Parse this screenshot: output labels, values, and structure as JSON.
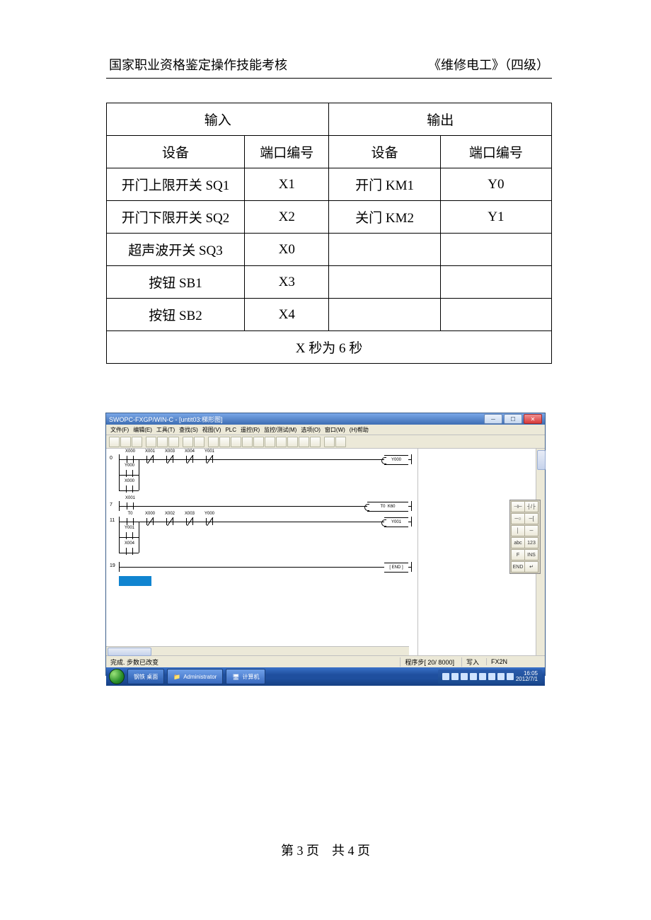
{
  "header": {
    "left": "国家职业资格鉴定操作技能考核",
    "right": "《维修电工》（四级）"
  },
  "iotable": {
    "h_input": "输入",
    "h_output": "输出",
    "h_dev": "设备",
    "h_port": "端口编号",
    "rows": [
      {
        "in_dev": "开门上限开关 SQ1",
        "in_port": "X1",
        "out_dev": "开门 KM1",
        "out_port": "Y0"
      },
      {
        "in_dev": "开门下限开关 SQ2",
        "in_port": "X2",
        "out_dev": "关门 KM2",
        "out_port": "Y1"
      },
      {
        "in_dev": "超声波开关 SQ3",
        "in_port": "X0",
        "out_dev": "",
        "out_port": ""
      },
      {
        "in_dev": "按钮 SB1",
        "in_port": "X3",
        "out_dev": "",
        "out_port": ""
      },
      {
        "in_dev": "按钮 SB2",
        "in_port": "X4",
        "out_dev": "",
        "out_port": ""
      }
    ],
    "footnote": "X 秒为 6 秒"
  },
  "app": {
    "title": "SWOPC-FXGP/WIN-C - [untit03:梯形图]",
    "menus": [
      "文件(F)",
      "编辑(E)",
      "工具(T)",
      "查找(S)",
      "视图(V)",
      "PLC",
      "遥控(R)",
      "监控/测试(M)",
      "选项(O)",
      "窗口(W)",
      "(H)帮助"
    ],
    "ladder": {
      "rung0": {
        "num": "0",
        "contacts": [
          "X000",
          "X001",
          "X003",
          "X004",
          "Y001"
        ],
        "closed": [
          false,
          true,
          true,
          true,
          true
        ],
        "coil": "Y000"
      },
      "branchA": [
        "Y000"
      ],
      "branchB": [
        "X000"
      ],
      "rung7": {
        "num": "7",
        "contacts": [
          "X001"
        ],
        "closed": [
          false
        ],
        "coil": "T0",
        "param": "K60"
      },
      "rung11": {
        "num": "11",
        "contacts": [
          "T0",
          "X000",
          "X002",
          "X003",
          "Y000"
        ],
        "closed": [
          false,
          true,
          true,
          true,
          true
        ],
        "coil": "Y001"
      },
      "branchC": [
        "Y001"
      ],
      "branchD": [
        "X004"
      ],
      "rung19": {
        "num": "19",
        "coil": "END"
      }
    },
    "status": {
      "left": "完成. 步数已改变",
      "steps": "程序步[  20/ 8000]",
      "write": "写入",
      "plc": "FX2N",
      "ins": "",
      "time": "16:05",
      "date": "2012/7/1"
    },
    "tasks": {
      "t1": "钢铁 桌面",
      "t2": "Administrator",
      "t3": "计算机"
    },
    "float_tools": [
      "⊣⊢",
      "┤/├",
      "─○",
      "─[",
      "│",
      "─",
      "abc",
      "123",
      "F",
      "INS",
      "END",
      "↵"
    ]
  },
  "footer": "第 3 页　共 4 页"
}
